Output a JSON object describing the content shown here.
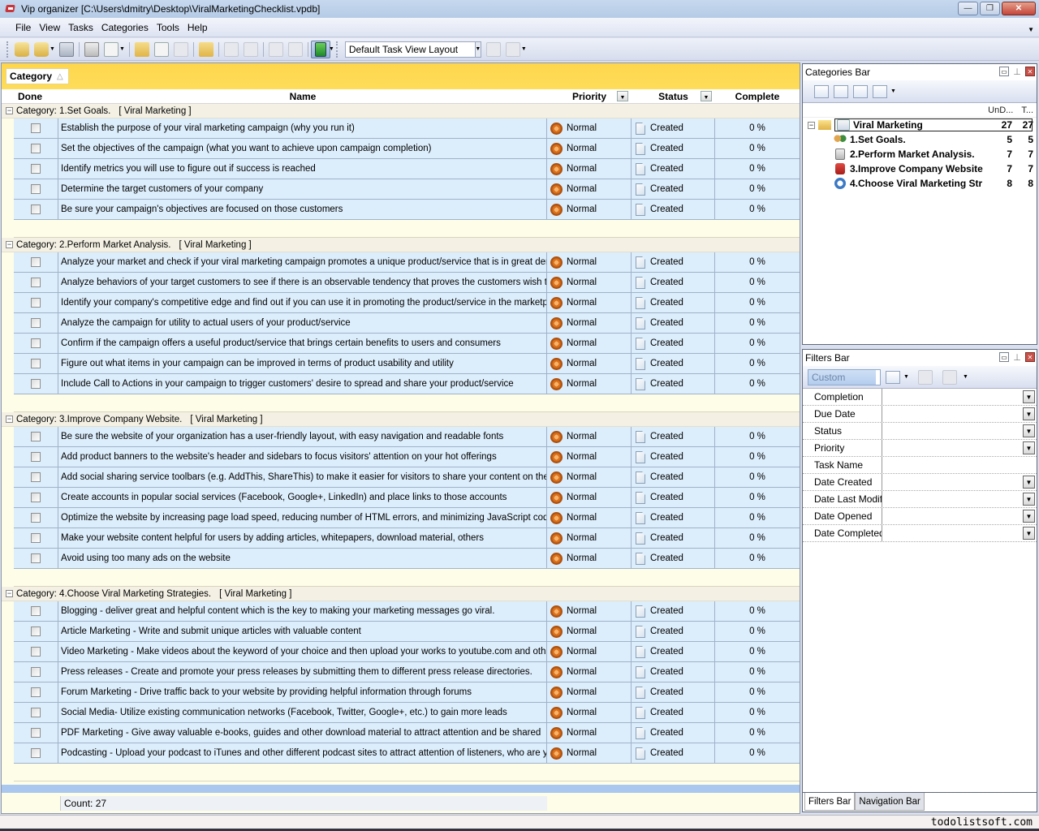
{
  "window": {
    "title": "Vip organizer [C:\\Users\\dmitry\\Desktop\\ViralMarketingChecklist.vpdb]",
    "buttons": {
      "minimize": "—",
      "restore": "❐",
      "close": "✕"
    }
  },
  "menu": [
    "File",
    "View",
    "Tasks",
    "Categories",
    "Tools",
    "Help"
  ],
  "toolbar": {
    "layout_select": "Default Task View Layout"
  },
  "grid": {
    "group_by_chip": "Category",
    "group_by_sort": "△",
    "columns": {
      "done": "Done",
      "name": "Name",
      "priority": "Priority",
      "status": "Status",
      "complete": "Complete"
    },
    "groups": [
      {
        "title": "Category: 1.Set Goals.",
        "parent": "[ Viral Marketing ]",
        "tasks": [
          {
            "name": "Establish the purpose of your viral marketing campaign (why you run it)",
            "priority": "Normal",
            "status": "Created",
            "complete": "0 %"
          },
          {
            "name": "Set the objectives of the campaign (what you want to achieve upon campaign completion)",
            "priority": "Normal",
            "status": "Created",
            "complete": "0 %"
          },
          {
            "name": "Identify metrics you will use to figure out  if success is reached",
            "priority": "Normal",
            "status": "Created",
            "complete": "0 %"
          },
          {
            "name": "Determine the target customers of your company",
            "priority": "Normal",
            "status": "Created",
            "complete": "0 %"
          },
          {
            "name": "Be sure your campaign's objectives are focused on those customers",
            "priority": "Normal",
            "status": "Created",
            "complete": "0 %"
          }
        ]
      },
      {
        "title": "Category: 2.Perform Market Analysis.",
        "parent": "[ Viral Marketing ]",
        "tasks": [
          {
            "name": "Analyze your market and check if your viral marketing campaign promotes a unique product/service that is in great demand",
            "priority": "Normal",
            "status": "Created",
            "complete": "0 %"
          },
          {
            "name": "Analyze behaviors of your target customers to see if there is an observable tendency that proves the customers wish to buy",
            "priority": "Normal",
            "status": "Created",
            "complete": "0 %"
          },
          {
            "name": "Identify your company's competitive edge and find out if you can use it in promoting the product/service in the marketplace",
            "priority": "Normal",
            "status": "Created",
            "complete": "0 %"
          },
          {
            "name": "Analyze the campaign for utility to actual users of your product/service",
            "priority": "Normal",
            "status": "Created",
            "complete": "0 %"
          },
          {
            "name": "Confirm if the campaign offers a useful product/service that brings certain benefits to users and consumers",
            "priority": "Normal",
            "status": "Created",
            "complete": "0 %"
          },
          {
            "name": "Figure out what items in your campaign can be improved in terms of product usability and utility",
            "priority": "Normal",
            "status": "Created",
            "complete": "0 %"
          },
          {
            "name": "Include Call to Actions in your campaign to trigger customers' desire to spread and share your product/service",
            "priority": "Normal",
            "status": "Created",
            "complete": "0 %"
          }
        ]
      },
      {
        "title": "Category: 3.Improve Company Website.",
        "parent": "[ Viral Marketing ]",
        "tasks": [
          {
            "name": "Be sure the website of your organization has a user-friendly layout, with easy navigation and readable fonts",
            "priority": "Normal",
            "status": "Created",
            "complete": "0 %"
          },
          {
            "name": "Add product banners to the website's header and sidebars to focus visitors' attention on your hot offerings",
            "priority": "Normal",
            "status": "Created",
            "complete": "0 %"
          },
          {
            "name": "Add social sharing service toolbars (e.g. AddThis, ShareThis) to make it easier for visitors to share your content on the Web",
            "priority": "Normal",
            "status": "Created",
            "complete": "0 %"
          },
          {
            "name": "Create accounts in popular social services (Facebook, Google+, LinkedIn) and place links to those accounts",
            "priority": "Normal",
            "status": "Created",
            "complete": "0 %"
          },
          {
            "name": "Optimize the website by increasing page load speed, reducing number of HTML errors, and minimizing JavaScript codes",
            "priority": "Normal",
            "status": "Created",
            "complete": "0 %"
          },
          {
            "name": "Make your website content helpful for users by adding articles, whitepapers, download material, others",
            "priority": "Normal",
            "status": "Created",
            "complete": "0 %"
          },
          {
            "name": "Avoid using too many ads on the website",
            "priority": "Normal",
            "status": "Created",
            "complete": "0 %"
          }
        ]
      },
      {
        "title": "Category: 4.Choose Viral Marketing Strategies.",
        "parent": "[ Viral Marketing ]",
        "tasks": [
          {
            "name": "Blogging - deliver great and helpful content which is the key to making your marketing messages go viral.",
            "priority": "Normal",
            "status": "Created",
            "complete": "0 %"
          },
          {
            "name": "Article Marketing - Write and submit unique articles with valuable content",
            "priority": "Normal",
            "status": "Created",
            "complete": "0 %"
          },
          {
            "name": "Video Marketing - Make videos about the keyword of your choice and then upload your works to youtube.com and other video",
            "priority": "Normal",
            "status": "Created",
            "complete": "0 %"
          },
          {
            "name": "Press releases - Create and promote your press releases by submitting them to different press release directories.",
            "priority": "Normal",
            "status": "Created",
            "complete": "0 %"
          },
          {
            "name": "Forum Marketing - Drive traffic back to your website by providing helpful information through forums",
            "priority": "Normal",
            "status": "Created",
            "complete": "0 %"
          },
          {
            "name": "Social Media- Utilize existing communication networks (Facebook, Twitter, Google+, etc.) to gain more leads",
            "priority": "Normal",
            "status": "Created",
            "complete": "0 %"
          },
          {
            "name": "PDF Marketing - Give away valuable e-books, guides and other download material to attract attention and be shared",
            "priority": "Normal",
            "status": "Created",
            "complete": "0 %"
          },
          {
            "name": "Podcasting - Upload your podcast to iTunes and other different podcast sites to attract attention of listeners, who are your",
            "priority": "Normal",
            "status": "Created",
            "complete": "0 %"
          }
        ]
      }
    ],
    "count": "Count: 27"
  },
  "categories_bar": {
    "title": "Categories Bar",
    "columns": [
      "UnD...",
      "T..."
    ],
    "root": {
      "name": "Viral Marketing",
      "undone": "27",
      "total": "27"
    },
    "children": [
      {
        "name": "1.Set Goals.",
        "undone": "5",
        "total": "5",
        "icon": "people"
      },
      {
        "name": "2.Perform Market Analysis.",
        "undone": "7",
        "total": "7",
        "icon": "cal"
      },
      {
        "name": "3.Improve Company Website",
        "undone": "7",
        "total": "7",
        "icon": "ribbon"
      },
      {
        "name": "4.Choose Viral Marketing Str",
        "undone": "8",
        "total": "8",
        "icon": "watch"
      }
    ]
  },
  "filters_bar": {
    "title": "Filters Bar",
    "preset": "Custom",
    "filters": [
      {
        "label": "Completion",
        "dropdown": true
      },
      {
        "label": "Due Date",
        "dropdown": true
      },
      {
        "label": "Status",
        "dropdown": true
      },
      {
        "label": "Priority",
        "dropdown": true
      },
      {
        "label": "Task Name",
        "dropdown": false
      },
      {
        "label": "Date Created",
        "dropdown": true
      },
      {
        "label": "Date Last Modified",
        "dropdown": true
      },
      {
        "label": "Date Opened",
        "dropdown": true
      },
      {
        "label": "Date Completed",
        "dropdown": true
      }
    ]
  },
  "bottom_tabs": [
    "Filters Bar",
    "Navigation Bar"
  ],
  "watermark": "todolistsoft.com",
  "colors": {
    "group_bar": "#fed64c",
    "row_bg": "#dcedfb",
    "priority_normal": "#d9711d",
    "selection_strip": "#a9c7ef"
  }
}
